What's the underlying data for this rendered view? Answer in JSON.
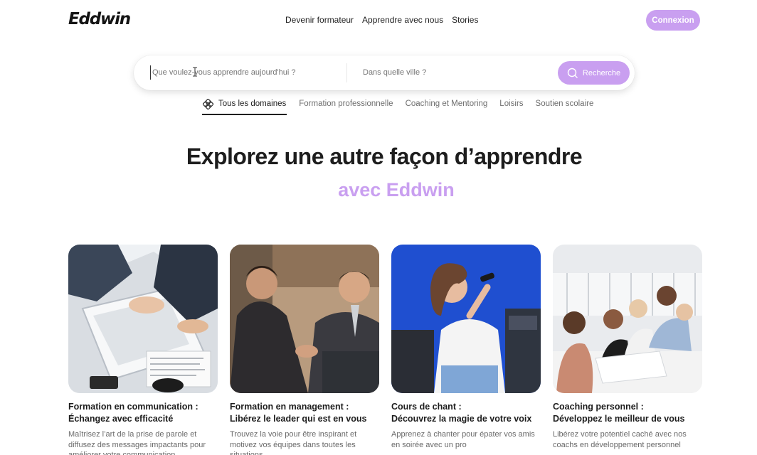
{
  "header": {
    "logo": "Eddwin",
    "nav": [
      "Devenir formateur",
      "Apprendre avec nous",
      "Stories"
    ],
    "login_label": "Connexion"
  },
  "search": {
    "what_placeholder": "Que voulez-vous apprendre aujourd'hui ?",
    "city_placeholder": "Dans quelle ville ?",
    "button_label": "Recherche",
    "button_icon": "search-icon"
  },
  "categories": [
    {
      "label": "Tous les domaines",
      "icon": "domains-icon",
      "active": true
    },
    {
      "label": "Formation professionnelle",
      "active": false
    },
    {
      "label": "Coaching et Mentoring",
      "active": false
    },
    {
      "label": "Loisirs",
      "active": false
    },
    {
      "label": "Soutien scolaire",
      "active": false
    }
  ],
  "hero": {
    "title": "Explorez une autre façon d’apprendre",
    "subtitle": "avec Eddwin"
  },
  "cards": [
    {
      "title_line1": "Formation en communication :",
      "title_line2": "Échangez avec efficacité",
      "description": "Maîtrisez l’art de la prise de parole et diffusez des messages impactants pour améliorer votre communication"
    },
    {
      "title_line1": "Formation en management :",
      "title_line2": "Libérez le leader qui est en vous",
      "description": "Trouvez la voie pour être inspirant et motivez vos équipes dans toutes les situations"
    },
    {
      "title_line1": "Cours de chant :",
      "title_line2": "Découvrez la magie de votre voix",
      "description": "Apprenez à chanter pour épater vos amis en soirée avec un pro"
    },
    {
      "title_line1": "Coaching personnel :",
      "title_line2": "Développez le meilleur de vous",
      "description": "Libérez votre potentiel caché avec nos coachs en développement personnel"
    }
  ],
  "colors": {
    "accent": "#c99ff0",
    "text": "#1d1d1d",
    "muted": "#6a6a6a"
  }
}
